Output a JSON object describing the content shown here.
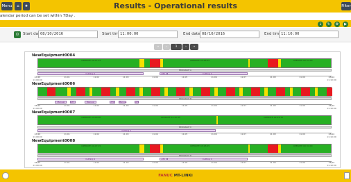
{
  "header": {
    "menu_label": "Menu",
    "title": "Results - Operational results",
    "right_label": "Filter"
  },
  "subtitle": "alendar period can be set within 7Day .",
  "filter": {
    "start_date_label": "Start date",
    "start_date_value": "08/10/2016",
    "start_time_label": "Start time",
    "start_time_value": "11:00:00",
    "end_date_label": "End date",
    "end_date_value": "08/10/2016",
    "end_time_label": "End time",
    "end_time_value": "11:10:00"
  },
  "footer": {
    "brand": "FANUC",
    "product": "MT-LINKi"
  },
  "colors": {
    "accent": "#f4c400",
    "run": "#27b023",
    "stop": "#e8191f",
    "alarm": "#f7e000",
    "button": "#2c7b36"
  },
  "ticks": [
    "08/10 11:00:00",
    "11:01",
    "11:02",
    "11:03",
    "11:04",
    "11:05",
    "11:06",
    "11:07",
    "11:08",
    "11:09",
    "08/10 11:10:00"
  ],
  "equipments": [
    {
      "name": "NewEquipment0004",
      "segments": [
        {
          "s": 0.345,
          "e": 0.36,
          "c": "#f7e000"
        },
        {
          "s": 0.38,
          "e": 0.415,
          "c": "#e8191f"
        },
        {
          "s": 0.415,
          "e": 0.425,
          "c": "#f7e000"
        },
        {
          "s": 0.715,
          "e": 0.72,
          "c": "#f7e000"
        },
        {
          "s": 0.78,
          "e": 0.815,
          "c": "#e8191f"
        },
        {
          "s": 0.815,
          "e": 0.825,
          "c": "#f7e000"
        }
      ],
      "labels": [
        {
          "x": 0.18,
          "text": "OPERATE 01:07:15"
        },
        {
          "x": 0.55,
          "text": "OPERATE 03:28:45"
        },
        {
          "x": 0.9,
          "text": "OPERATE 00:34:00"
        }
      ],
      "prog_text": "PROGRAM A",
      "ops": [
        {
          "s": 0.0,
          "e": 0.36,
          "t": "Cutting 1"
        },
        {
          "s": 0.415,
          "e": 0.44,
          "t": "ATC"
        },
        {
          "s": 0.44,
          "e": 0.715,
          "t": "Cutting 1"
        }
      ]
    },
    {
      "name": "NewEquipment0006",
      "segments": [
        {
          "s": 0.03,
          "e": 0.06,
          "c": "#e8191f"
        },
        {
          "s": 0.1,
          "e": 0.11,
          "c": "#f7e000"
        },
        {
          "s": 0.13,
          "e": 0.16,
          "c": "#e8191f"
        },
        {
          "s": 0.175,
          "e": 0.185,
          "c": "#f7e000"
        },
        {
          "s": 0.215,
          "e": 0.245,
          "c": "#e8191f"
        },
        {
          "s": 0.265,
          "e": 0.275,
          "c": "#f7e000"
        },
        {
          "s": 0.3,
          "e": 0.33,
          "c": "#e8191f"
        },
        {
          "s": 0.345,
          "e": 0.355,
          "c": "#f7e000"
        },
        {
          "s": 0.385,
          "e": 0.415,
          "c": "#e8191f"
        },
        {
          "s": 0.43,
          "e": 0.44,
          "c": "#f7e000"
        },
        {
          "s": 0.47,
          "e": 0.5,
          "c": "#e8191f"
        },
        {
          "s": 0.515,
          "e": 0.525,
          "c": "#f7e000"
        },
        {
          "s": 0.555,
          "e": 0.585,
          "c": "#e8191f"
        },
        {
          "s": 0.6,
          "e": 0.61,
          "c": "#f7e000"
        },
        {
          "s": 0.64,
          "e": 0.67,
          "c": "#e8191f"
        },
        {
          "s": 0.685,
          "e": 0.695,
          "c": "#f7e000"
        },
        {
          "s": 0.725,
          "e": 0.755,
          "c": "#e8191f"
        },
        {
          "s": 0.77,
          "e": 0.78,
          "c": "#f7e000"
        },
        {
          "s": 0.81,
          "e": 0.84,
          "c": "#e8191f"
        },
        {
          "s": 0.855,
          "e": 0.865,
          "c": "#f7e000"
        },
        {
          "s": 0.895,
          "e": 0.925,
          "c": "#e8191f"
        },
        {
          "s": 0.94,
          "e": 0.95,
          "c": "#f7e000"
        },
        {
          "s": 0.98,
          "e": 1.0,
          "c": "#e8191f"
        }
      ],
      "labels": [],
      "prog_text": "PROGRAM B",
      "ops": [
        {
          "s": 0.06,
          "e": 0.1,
          "t": "Manual"
        },
        {
          "s": 0.11,
          "e": 0.13,
          "t": "ATC"
        },
        {
          "s": 0.16,
          "e": 0.2,
          "t": "Manual"
        },
        {
          "s": 0.245,
          "e": 0.265,
          "t": "ATC"
        },
        {
          "s": 0.275,
          "e": 0.3,
          "t": "Manual"
        },
        {
          "s": 0.33,
          "e": 0.345,
          "t": "ATC"
        }
      ]
    },
    {
      "name": "NewEquipment0007",
      "segments": [
        {
          "s": 0.605,
          "e": 0.61,
          "c": "#f7e000"
        }
      ],
      "labels": [
        {
          "x": 0.18,
          "text": "OPERATE 03:00:00"
        },
        {
          "x": 0.45,
          "text": "OPERATE 04:10:45"
        },
        {
          "x": 0.8,
          "text": "OPERATE 02:49:15"
        }
      ],
      "prog_text": "PROGRAM C",
      "ops": [
        {
          "s": 0.0,
          "e": 0.605,
          "t": "Cutting 1"
        }
      ]
    },
    {
      "name": "NewEquipment0008",
      "segments": [
        {
          "s": 0.345,
          "e": 0.36,
          "c": "#f7e000"
        },
        {
          "s": 0.38,
          "e": 0.415,
          "c": "#e8191f"
        },
        {
          "s": 0.415,
          "e": 0.425,
          "c": "#f7e000"
        },
        {
          "s": 0.715,
          "e": 0.72,
          "c": "#f7e000"
        },
        {
          "s": 0.78,
          "e": 0.815,
          "c": "#e8191f"
        },
        {
          "s": 0.815,
          "e": 0.825,
          "c": "#f7e000"
        }
      ],
      "labels": [
        {
          "x": 0.18,
          "text": "OPERATE 01:07:15"
        },
        {
          "x": 0.55,
          "text": "OPERATE 03:28:45"
        },
        {
          "x": 0.9,
          "text": "OPERATE 00:34:00"
        }
      ],
      "prog_text": "PROGRAM D",
      "ops": [
        {
          "s": 0.0,
          "e": 0.36,
          "t": "Cutting 1"
        },
        {
          "s": 0.415,
          "e": 0.44,
          "t": "ATC"
        },
        {
          "s": 0.44,
          "e": 0.715,
          "t": "Cutting 1"
        }
      ]
    }
  ]
}
